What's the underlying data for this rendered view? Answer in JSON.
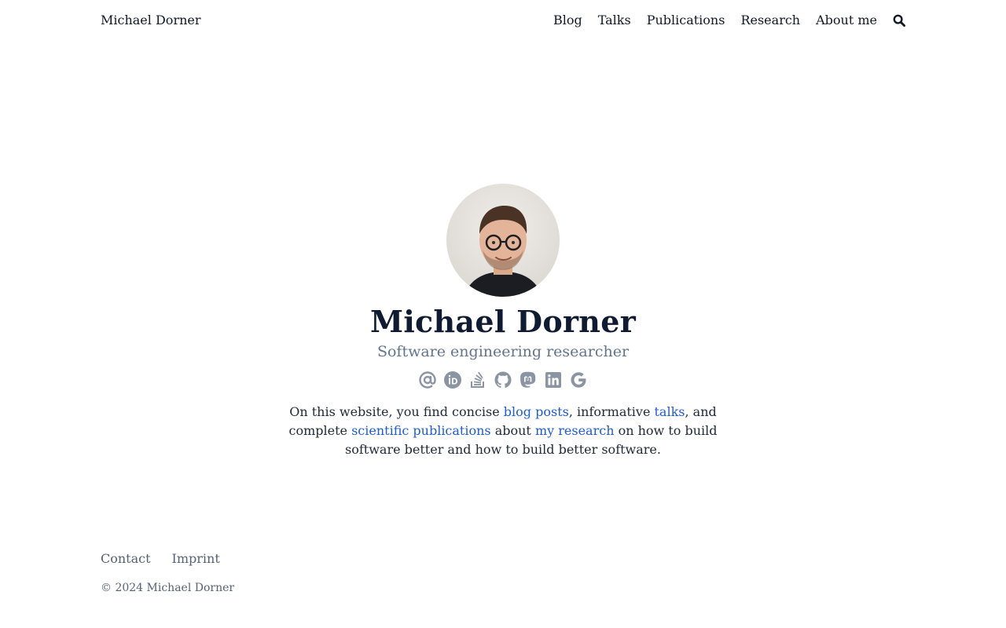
{
  "header": {
    "site_title": "Michael Dorner",
    "nav": [
      "Blog",
      "Talks",
      "Publications",
      "Research",
      "About me"
    ],
    "search_icon": "search-icon"
  },
  "hero": {
    "name": "Michael Dorner",
    "tagline": "Software engineering researcher",
    "socials": [
      "email-icon",
      "orcid-icon",
      "stackoverflow-icon",
      "github-icon",
      "mastodon-icon",
      "linkedin-icon",
      "google-scholar-icon"
    ],
    "intro": {
      "t1": "On this website, you find concise ",
      "l1": "blog posts",
      "t2": ", informative ",
      "l2": "talks",
      "t3": ", and complete ",
      "l3": "scientific publications",
      "t4": " about ",
      "l4": "my research",
      "t5": " on how to build software better and how to build better software."
    }
  },
  "footer": {
    "links": [
      "Contact",
      "Imprint"
    ],
    "copyright": "© 2024 Michael Dorner"
  },
  "colors": {
    "link": "#1e5bd8",
    "name": "#0f1b33",
    "muted": "#64748b",
    "icon": "#8a94a3"
  }
}
